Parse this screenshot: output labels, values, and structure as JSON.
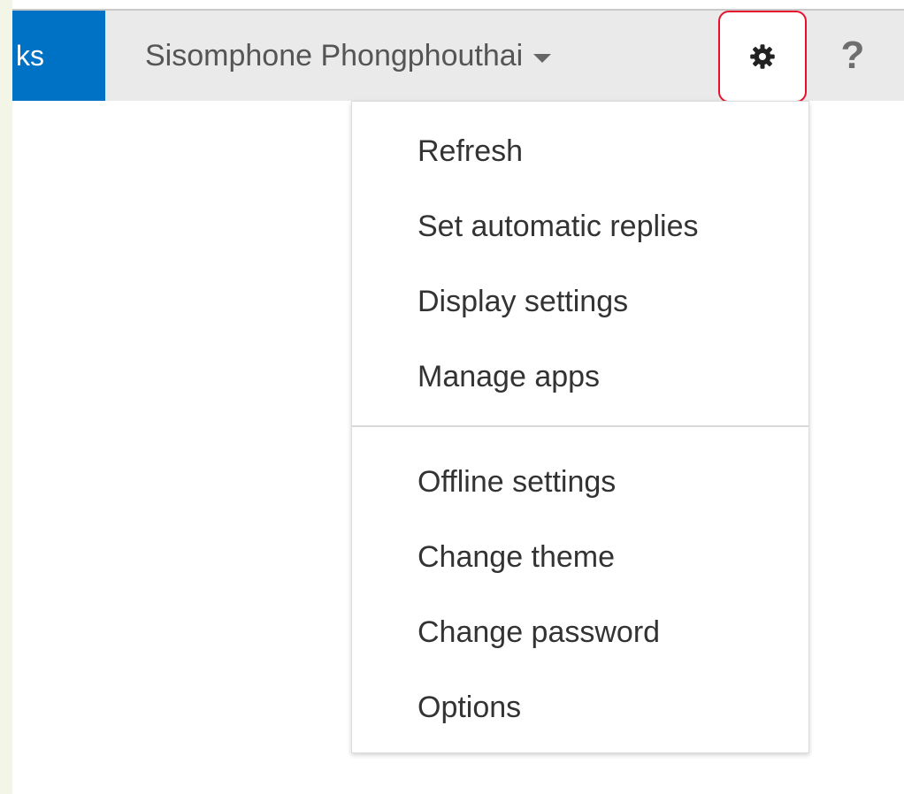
{
  "header": {
    "nav_tab_label": "ks",
    "user_name": "Sisomphone Phongphouthai",
    "help_label": "?",
    "accent_color": "#0072c6",
    "highlight_color": "#e8112d"
  },
  "settings_menu": {
    "group1": [
      "Refresh",
      "Set automatic replies",
      "Display settings",
      "Manage apps"
    ],
    "group2": [
      "Offline settings",
      "Change theme",
      "Change password",
      "Options"
    ]
  },
  "icons": {
    "settings": "gear-icon",
    "user_dropdown": "chevron-down-icon"
  }
}
